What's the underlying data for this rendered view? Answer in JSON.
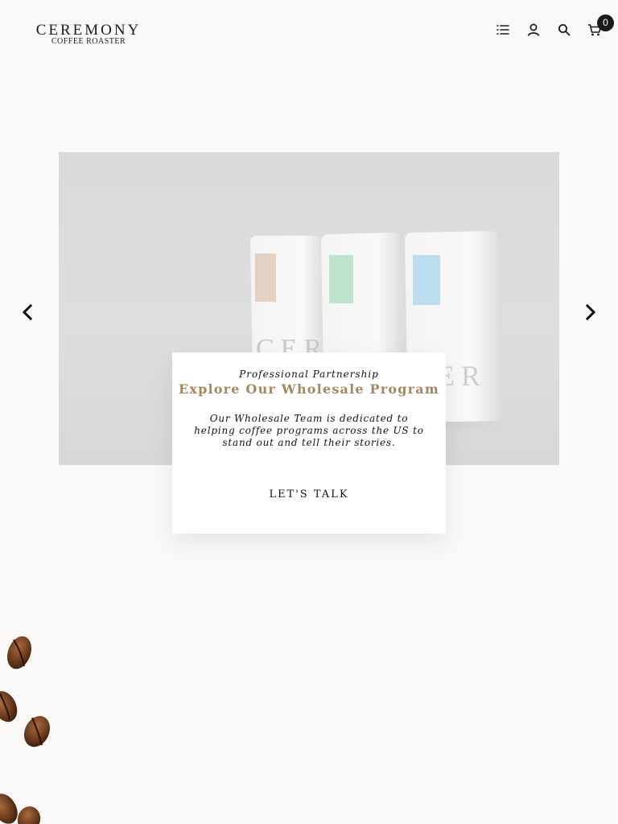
{
  "brand": {
    "name": "CEREMONY",
    "tagline": "COFFEE ROASTER"
  },
  "header": {
    "icons": [
      "list-icon",
      "user-icon",
      "search-icon",
      "cart-icon"
    ],
    "cart_count": "0"
  },
  "hero": {
    "slide": {
      "kicker": "Professional Partnership",
      "title": "Explore Our Wholesale Program",
      "body": "Our Wholesale Team is dedicated to helping coffee programs across the US to stand out and tell their stories.",
      "cta": "LET'S TALK"
    }
  },
  "colors": {
    "accent": "#a5875f",
    "background": "#fbf9f8",
    "text": "#111111"
  }
}
